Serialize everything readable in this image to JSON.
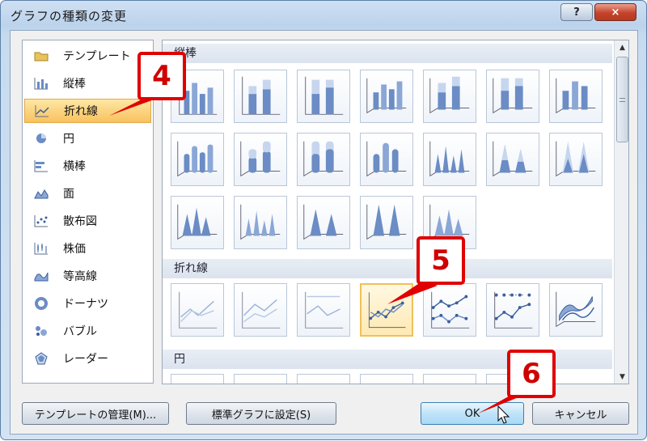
{
  "window": {
    "title": "グラフの種類の変更",
    "help_label": "?",
    "close_label": "×"
  },
  "categories": [
    {
      "label": "テンプレート",
      "icon": "folder-icon"
    },
    {
      "label": "縦棒",
      "icon": "column-chart-icon"
    },
    {
      "label": "折れ線",
      "icon": "line-chart-icon"
    },
    {
      "label": "円",
      "icon": "pie-chart-icon"
    },
    {
      "label": "横棒",
      "icon": "bar-chart-icon"
    },
    {
      "label": "面",
      "icon": "area-chart-icon"
    },
    {
      "label": "散布図",
      "icon": "scatter-chart-icon"
    },
    {
      "label": "株価",
      "icon": "stock-chart-icon"
    },
    {
      "label": "等高線",
      "icon": "surface-chart-icon"
    },
    {
      "label": "ドーナツ",
      "icon": "doughnut-chart-icon"
    },
    {
      "label": "バブル",
      "icon": "bubble-chart-icon"
    },
    {
      "label": "レーダー",
      "icon": "radar-chart-icon"
    }
  ],
  "selected_category": "折れ線",
  "gallery": {
    "sections": [
      {
        "title": "縦棒"
      },
      {
        "title": "折れ線"
      },
      {
        "title": "円"
      }
    ]
  },
  "buttons": {
    "manage_templates": "テンプレートの管理(M)...",
    "set_default": "標準グラフに設定(S)",
    "ok": "OK",
    "cancel": "キャンセル"
  },
  "callouts": [
    "4",
    "5",
    "6"
  ],
  "colors": {
    "accent_red": "#e00000",
    "selection_orange": "#f9c25e",
    "chart_blue": "#5b7fb8"
  }
}
